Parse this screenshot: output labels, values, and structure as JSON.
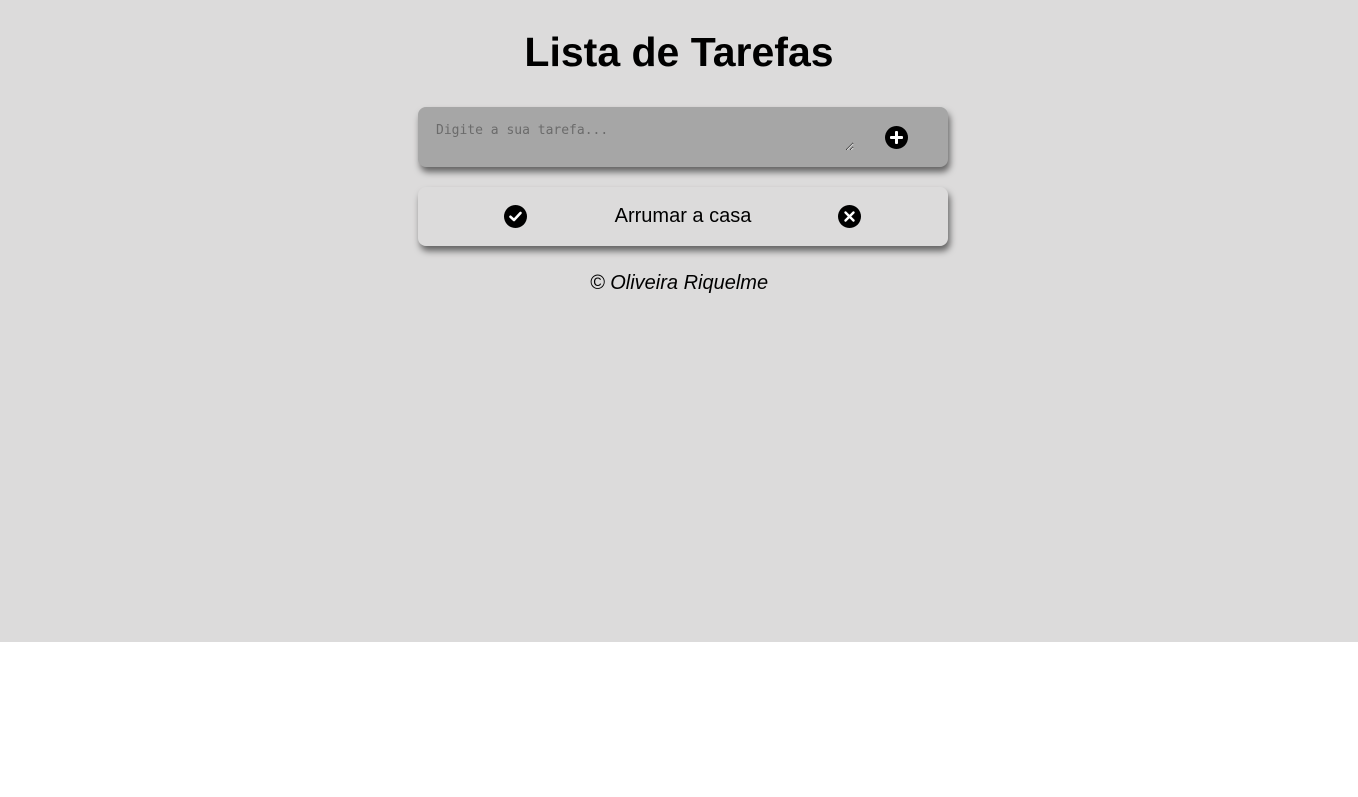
{
  "header": {
    "title": "Lista de Tarefas"
  },
  "form": {
    "placeholder": "Digite a sua tarefa...",
    "value": "",
    "add_icon": "plus-circle-icon"
  },
  "tasks": [
    {
      "label": "Arrumar a casa",
      "complete_icon": "check-circle-icon",
      "remove_icon": "x-circle-icon"
    }
  ],
  "footer": {
    "text": "© Oliveira Riquelme"
  },
  "colors": {
    "background": "#dcdbdb",
    "input_card": "#a6a6a6",
    "icon": "#000000"
  }
}
